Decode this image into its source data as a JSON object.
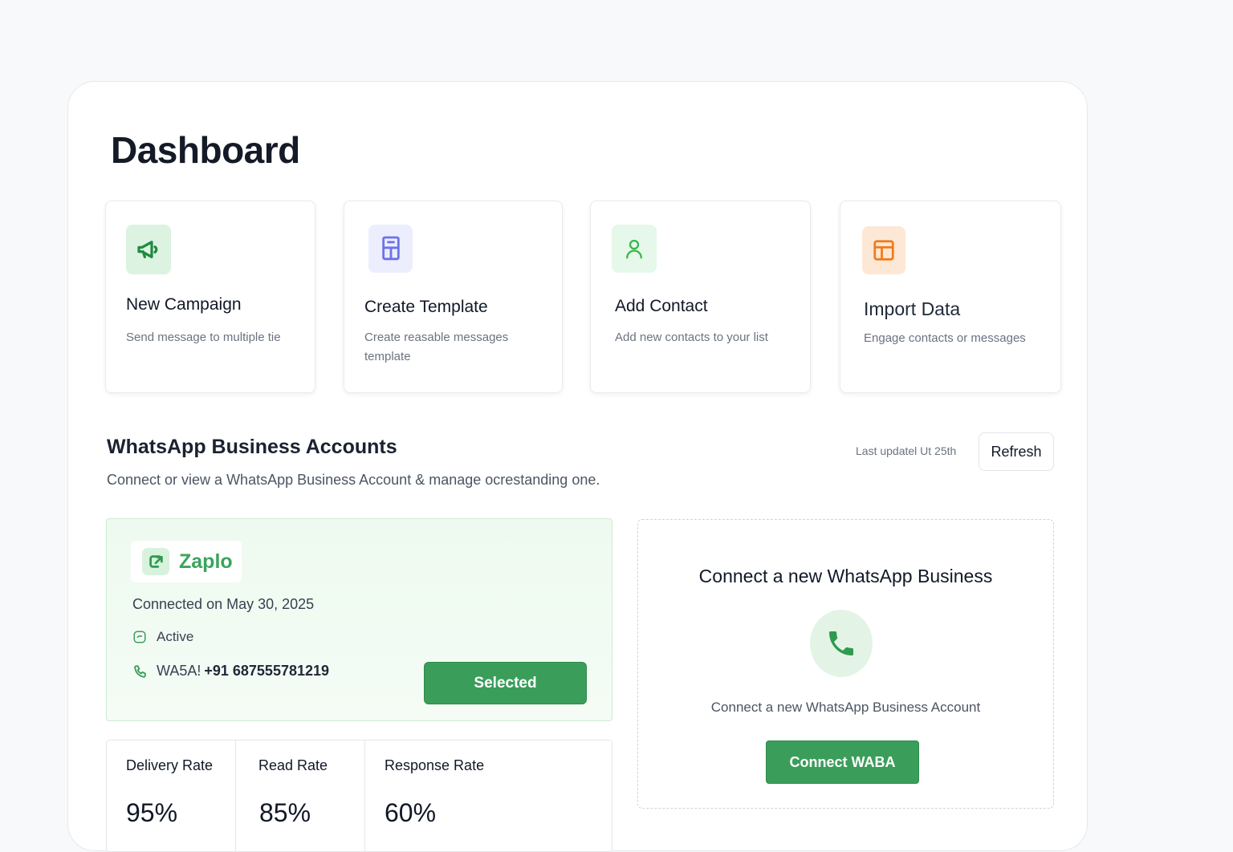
{
  "page": {
    "title": "Dashboard"
  },
  "quick_actions": [
    {
      "title": "New Campaign",
      "description": "Send message to multiple tie",
      "icon": "megaphone-icon",
      "accent": "#1f8a3f",
      "bg": "#dcf3e1"
    },
    {
      "title": "Create Template",
      "description": "Create reasable messages template",
      "icon": "template-icon",
      "accent": "#6d72e8",
      "bg": "#eceefd"
    },
    {
      "title": "Add Contact",
      "description": "Add new contacts to your list",
      "icon": "user-icon",
      "accent": "#33b84a",
      "bg": "#e6f8e9"
    },
    {
      "title": "Import Data",
      "description": "Engage contacts or messages",
      "icon": "layout-icon",
      "accent": "#f27a1a",
      "bg": "#fde8d6"
    }
  ],
  "waba": {
    "title": "WhatsApp Business Accounts",
    "subtitle": "Connect or view a WhatsApp Business Account & manage ocrestanding one.",
    "last_updated": "Last updatel Ut 25th",
    "refresh_label": "Refresh"
  },
  "account": {
    "brand": "Zaplo",
    "connected_on": "Connected on May 30, 2025",
    "status": "Active",
    "phone_prefix": "WA5A!",
    "phone_number": "+91 687555781219",
    "selected_label": "Selected",
    "brand_color": "#3aa45c"
  },
  "stats": [
    {
      "label": "Delivery Rate",
      "value": "95%"
    },
    {
      "label": "Read Rate",
      "value": "85%"
    },
    {
      "label": "Response Rate",
      "value": "60%"
    }
  ],
  "connect": {
    "title": "Connect a new WhatsApp Business",
    "description": "Connect a new WhatsApp Business  Account",
    "button_label": "Connect WABA",
    "icon": "phone-icon"
  }
}
